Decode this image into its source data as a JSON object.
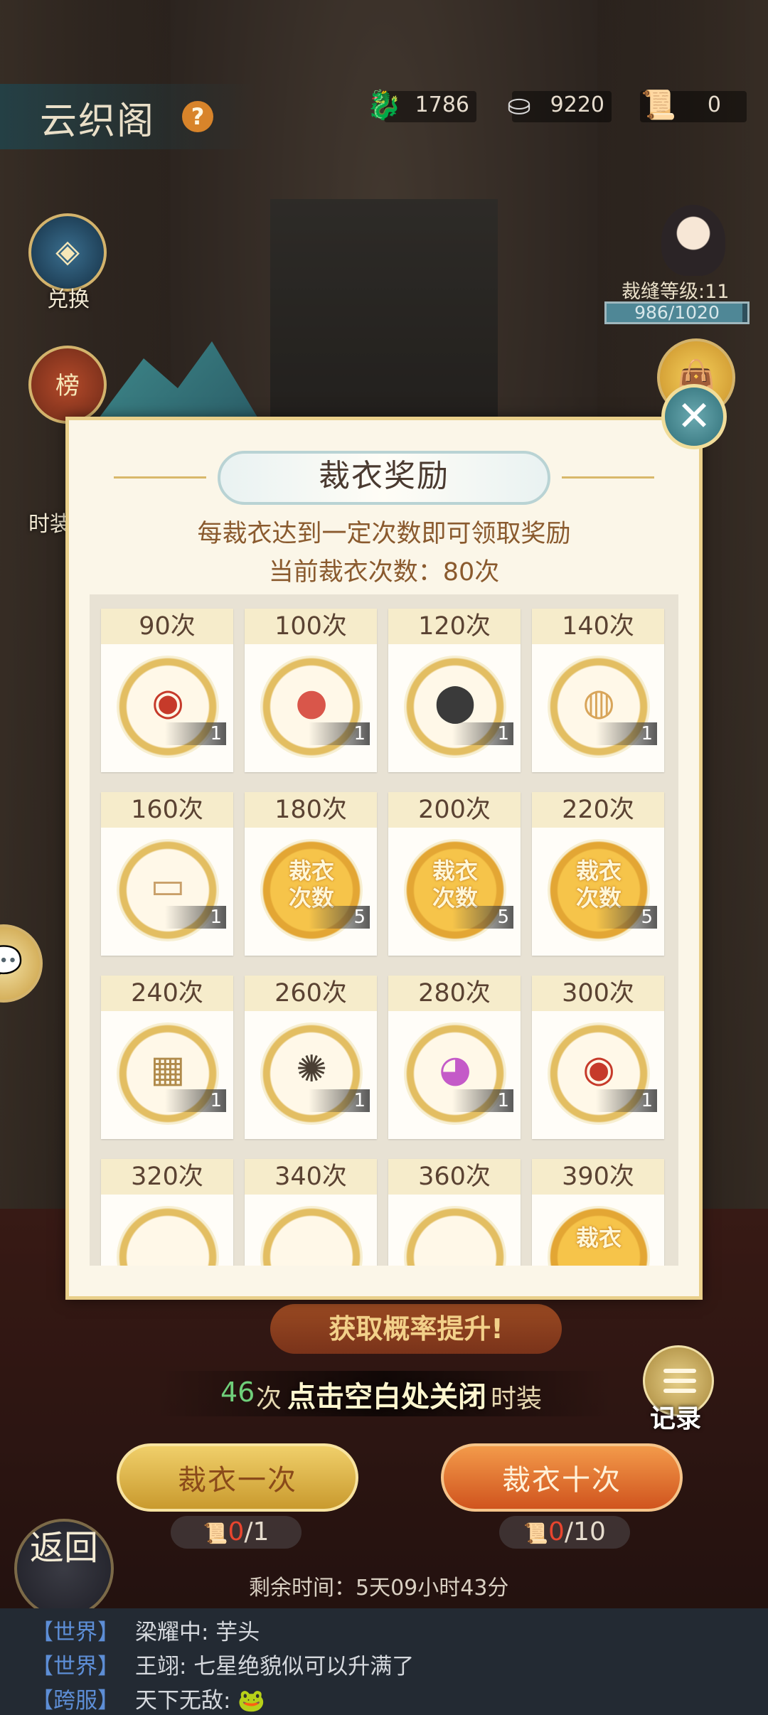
{
  "header": {
    "title": "云织阁",
    "resources": [
      {
        "icon": "jade-dragon-icon",
        "value": "1786"
      },
      {
        "icon": "silver-ingot-icon",
        "value": "9220"
      },
      {
        "icon": "scroll-ticket-icon",
        "value": "0"
      }
    ]
  },
  "side": {
    "exchange_label": "兑换",
    "fashion_label": "时装",
    "rank_label": "榜"
  },
  "player": {
    "level_text": "裁缝等级:11",
    "exp_text": "986/1020",
    "exp_fraction": 0.967
  },
  "modal": {
    "title": "裁衣奖励",
    "description": "每裁衣达到一定次数即可领取奖励",
    "current_count_text": "当前裁衣次数：80次",
    "rewards": [
      {
        "label": "90次",
        "icon": "eye-palette-icon",
        "count": "1"
      },
      {
        "label": "100次",
        "icon": "rouge-compact-icon",
        "count": "1"
      },
      {
        "label": "120次",
        "icon": "black-tin-box-icon",
        "count": "1"
      },
      {
        "label": "140次",
        "icon": "amber-bowl-icon",
        "count": "1"
      },
      {
        "label": "160次",
        "icon": "blank-frame-icon",
        "count": "1"
      },
      {
        "label": "180次",
        "icon": "tailor-count-badge-icon",
        "count": "5",
        "badge": "裁衣次数"
      },
      {
        "label": "200次",
        "icon": "tailor-count-badge-icon",
        "count": "5",
        "badge": "裁衣次数"
      },
      {
        "label": "220次",
        "icon": "tailor-count-badge-icon",
        "count": "5",
        "badge": "裁衣次数"
      },
      {
        "label": "240次",
        "icon": "jewel-case-icon",
        "count": "1"
      },
      {
        "label": "260次",
        "icon": "hairpin-box-icon",
        "count": "1"
      },
      {
        "label": "280次",
        "icon": "rainbow-compact-icon",
        "count": "1"
      },
      {
        "label": "300次",
        "icon": "eye-palette-icon",
        "count": "1"
      },
      {
        "label": "320次",
        "icon": "rouge-compact-icon"
      },
      {
        "label": "340次",
        "icon": "black-tin-box-icon"
      },
      {
        "label": "360次",
        "icon": "portrait-frame-icon"
      },
      {
        "label": "390次",
        "icon": "tailor-count-badge-icon",
        "badge": "裁衣"
      }
    ]
  },
  "bottom": {
    "banner_text": "获取概率提升!",
    "hint_count": "46",
    "hint_unit": "次",
    "hint_close": "点击空白处关闭",
    "hint_suffix": "时装",
    "record_label": "记录",
    "once_label": "裁衣一次",
    "ten_label": "裁衣十次",
    "once_cost_have": "0",
    "once_cost_need": "/1",
    "ten_cost_have": "0",
    "ten_cost_need": "/10",
    "back_label": "返回",
    "remaining_text": "剩余时间：5天09小时43分"
  },
  "chat": [
    {
      "channel": "【世界】",
      "message": "梁耀中: 芋头"
    },
    {
      "channel": "【世界】",
      "message": "王翊: 七星绝貌似可以升满了"
    },
    {
      "channel": "【跨服】",
      "message": "天下无敌: 🐸"
    }
  ]
}
